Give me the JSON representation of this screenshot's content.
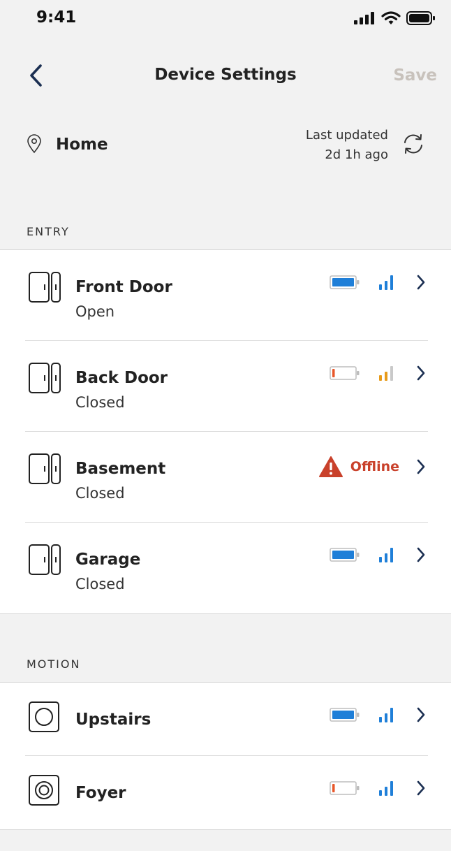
{
  "status_bar": {
    "time": "9:41"
  },
  "nav": {
    "back_label": "",
    "title": "Device Settings",
    "save_label": "Save"
  },
  "location": {
    "name": "Home",
    "last_updated_line1": "Last updated",
    "last_updated_line2": "2d 1h ago"
  },
  "colors": {
    "accent_blue": "#1f7fd8",
    "warning_orange": "#e79b1a",
    "battery_low": "#e8572a",
    "offline_red": "#c9412b",
    "save_disabled": "#c8c2bc"
  },
  "sections": [
    {
      "label": "ENTRY",
      "devices": [
        {
          "name": "Front Door",
          "state": "Open",
          "icon": "door-sensor-icon",
          "battery": 1.0,
          "signal": "good"
        },
        {
          "name": "Back Door",
          "state": "Closed",
          "icon": "door-sensor-icon",
          "battery": 0.1,
          "signal": "weak"
        },
        {
          "name": "Basement",
          "state": "Closed",
          "icon": "door-sensor-icon",
          "offline_label": "Offline"
        },
        {
          "name": "Garage",
          "state": "Closed",
          "icon": "door-sensor-icon",
          "battery": 1.0,
          "signal": "good"
        }
      ]
    },
    {
      "label": "MOTION",
      "devices": [
        {
          "name": "Upstairs",
          "icon": "motion-sensor-icon",
          "battery": 1.0,
          "signal": "good"
        },
        {
          "name": "Foyer",
          "icon": "motion-sensor-dual-icon",
          "battery": 0.1,
          "signal": "good"
        }
      ]
    }
  ]
}
